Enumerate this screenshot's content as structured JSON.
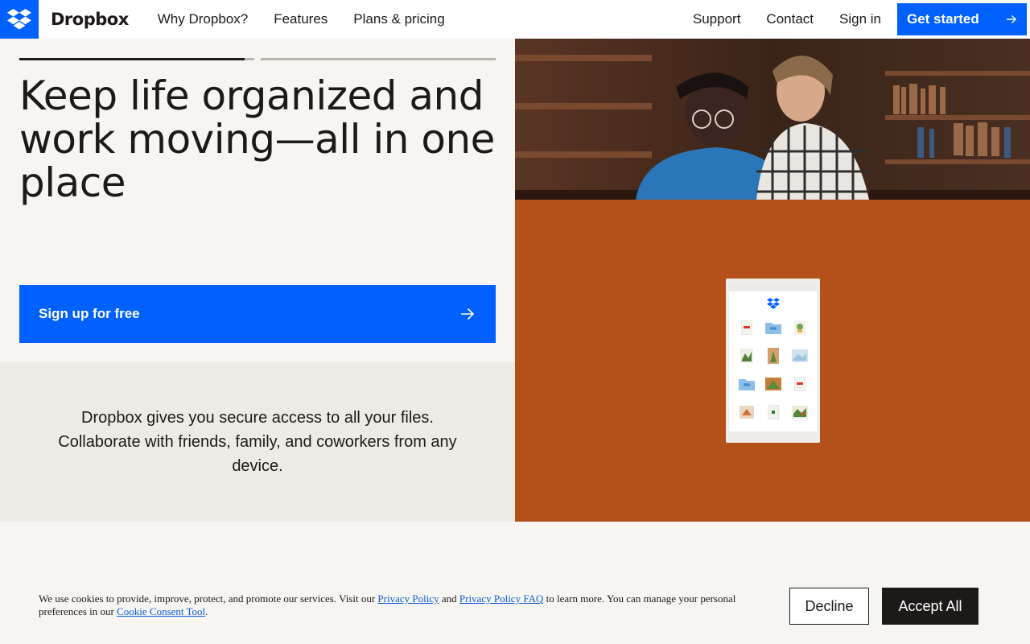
{
  "header": {
    "brand": "Dropbox",
    "nav": [
      "Why Dropbox?",
      "Features",
      "Plans & pricing"
    ],
    "right": [
      "Support",
      "Contact",
      "Sign in"
    ],
    "cta": "Get started"
  },
  "hero": {
    "headline": "Keep life organized and work moving—all in one place",
    "signup": "Sign up for free",
    "description": "Dropbox gives you secure access to all your files. Collaborate with friends, family, and coworkers from any device.",
    "carousel_progress": [
      0.96,
      0
    ]
  },
  "colors": {
    "brand_blue": "#0061fe",
    "orange": "#b4501a",
    "dark": "#1e1919"
  },
  "cookie": {
    "text_a": "We use cookies to provide, improve, protect, and promote our services. Visit our ",
    "link1": "Privacy Policy",
    "text_b": " and ",
    "link2": "Privacy Policy FAQ",
    "text_c": " to learn more. You can manage your personal preferences in our ",
    "link3": "Cookie Consent Tool",
    "text_d": ".",
    "decline": "Decline",
    "accept": "Accept All"
  },
  "icons": [
    "dropbox-logo-icon",
    "arrow-right-icon"
  ]
}
